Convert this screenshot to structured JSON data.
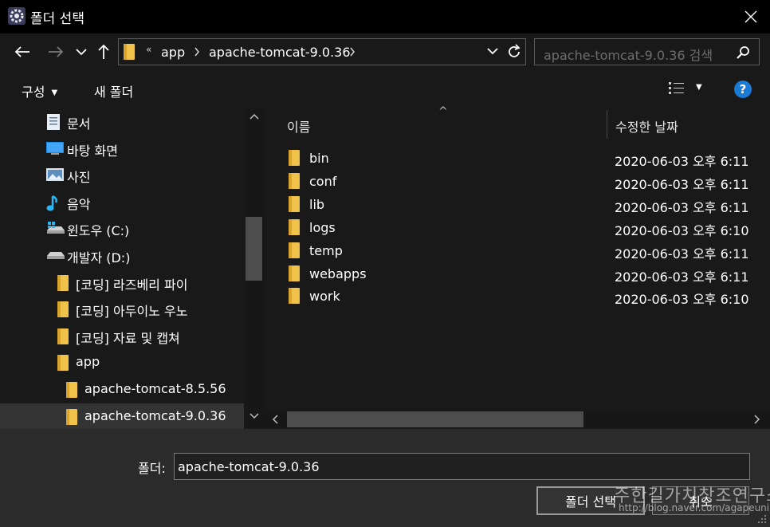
{
  "window": {
    "title": "폴더 선택",
    "app_icon": "gear-app-icon",
    "close_icon": "close-icon"
  },
  "nav": {
    "back_icon": "arrow-left-icon",
    "forward_icon": "arrow-right-icon",
    "recent_icon": "chevron-down-icon",
    "up_icon": "arrow-up-icon"
  },
  "address": {
    "overflow": "«",
    "crumbs": [
      "app",
      "apache-tomcat-9.0.36"
    ]
  },
  "search": {
    "placeholder": "apache-tomcat-9.0.36 검색"
  },
  "toolbar": {
    "organize_label": "구성",
    "new_folder_label": "새 폴더"
  },
  "tree": {
    "items": [
      {
        "label": "문서",
        "icon": "document-icon"
      },
      {
        "label": "바탕 화면",
        "icon": "desktop-icon"
      },
      {
        "label": "사진",
        "icon": "pictures-icon"
      },
      {
        "label": "음악",
        "icon": "music-icon"
      },
      {
        "label": "윈도우 (C:)",
        "icon": "windows-drive-icon"
      },
      {
        "label": "개발자 (D:)",
        "icon": "drive-icon"
      },
      {
        "label": "[코딩] 라즈베리 파이",
        "icon": "folder-icon"
      },
      {
        "label": "[코딩] 아두이노 우노",
        "icon": "folder-icon"
      },
      {
        "label": "[코딩] 자료 및 캡쳐",
        "icon": "folder-icon"
      },
      {
        "label": "app",
        "icon": "folder-icon"
      },
      {
        "label": "apache-tomcat-8.5.56",
        "icon": "folder-icon"
      },
      {
        "label": "apache-tomcat-9.0.36",
        "icon": "folder-icon",
        "selected": true
      }
    ]
  },
  "columns": {
    "name": "이름",
    "date": "수정한 날짜"
  },
  "files": [
    {
      "name": "bin",
      "date": "2020-06-03 오후 6:11"
    },
    {
      "name": "conf",
      "date": "2020-06-03 오후 6:11"
    },
    {
      "name": "lib",
      "date": "2020-06-03 오후 6:11"
    },
    {
      "name": "logs",
      "date": "2020-06-03 오후 6:10"
    },
    {
      "name": "temp",
      "date": "2020-06-03 오후 6:11"
    },
    {
      "name": "webapps",
      "date": "2020-06-03 오후 6:11"
    },
    {
      "name": "work",
      "date": "2020-06-03 오후 6:10"
    }
  ],
  "footer": {
    "folder_label": "폴더:",
    "folder_value": "apache-tomcat-9.0.36",
    "select_button": "폴더 선택",
    "cancel_button": "취소"
  },
  "watermark": {
    "text": "주한길가치창조연구소",
    "url": "http://blog.naver.com/agapeuni"
  },
  "colors": {
    "folder": "#f0c24a",
    "accent": "#1a7bd4",
    "background": "#191919"
  }
}
